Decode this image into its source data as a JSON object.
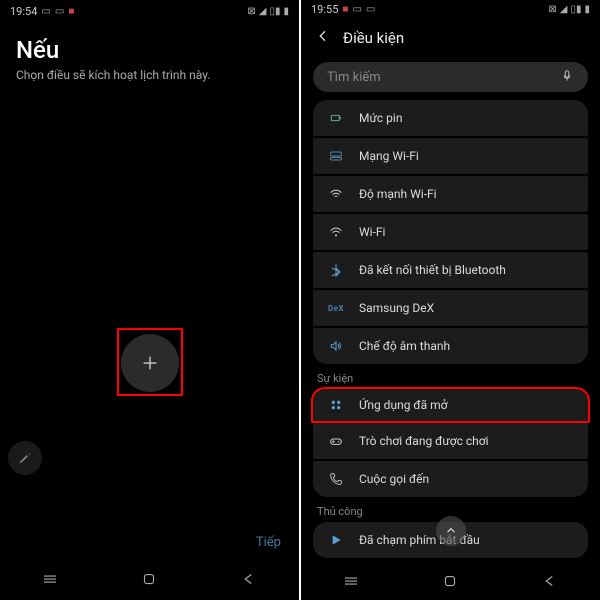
{
  "left": {
    "status_time": "19:54",
    "title": "Nếu",
    "subtitle": "Chọn điều sẽ kích hoạt lịch trình này.",
    "next_label": "Tiếp"
  },
  "right": {
    "status_time": "19:55",
    "header_title": "Điều kiện",
    "search_placeholder": "Tìm kiếm",
    "section_events": "Sự kiện",
    "section_manual": "Thủ công",
    "items_status": [
      {
        "label": "Mức pin"
      },
      {
        "label": "Mạng Wi-Fi"
      },
      {
        "label": "Độ mạnh Wi-Fi"
      },
      {
        "label": "Wi-Fi"
      },
      {
        "label": "Đã kết nối thiết bị Bluetooth"
      },
      {
        "label": "Samsung DeX"
      },
      {
        "label": "Chế độ âm thanh"
      }
    ],
    "items_events": [
      {
        "label": "Ứng dụng đã mở"
      },
      {
        "label": "Trò chơi đang được chơi"
      },
      {
        "label": "Cuộc gọi đến"
      }
    ],
    "items_manual": [
      {
        "label": "Đã chạm phím bắt đầu"
      }
    ]
  }
}
